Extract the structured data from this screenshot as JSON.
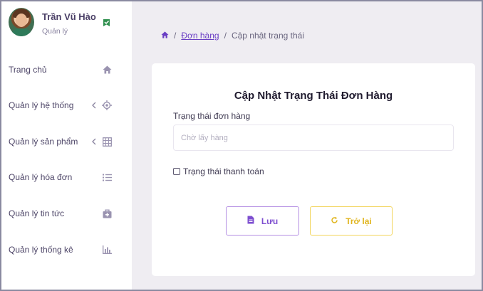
{
  "user": {
    "name": "Trần Vũ Hào",
    "role": "Quản lý"
  },
  "sidebar": {
    "items": [
      {
        "label": "Trang chủ",
        "icon": "home-icon",
        "has_chevron": false
      },
      {
        "label": "Quản lý hệ thống",
        "icon": "settings-target-icon",
        "has_chevron": true
      },
      {
        "label": "Quản lý sản phẩm",
        "icon": "grid-icon",
        "has_chevron": true
      },
      {
        "label": "Quản lý hóa đơn",
        "icon": "list-icon",
        "has_chevron": false
      },
      {
        "label": "Quản lý tin tức",
        "icon": "briefcase-plus-icon",
        "has_chevron": false
      },
      {
        "label": "Quản lý thống kê",
        "icon": "bar-chart-icon",
        "has_chevron": false
      }
    ]
  },
  "breadcrumb": {
    "separator": "/",
    "link": "Đơn hàng",
    "current": "Cập nhật trạng thái"
  },
  "form": {
    "title": "Cập Nhật Trạng Thái Đơn Hàng",
    "status_label": "Trạng thái đơn hàng",
    "status_placeholder": "Chờ lấy hàng",
    "payment_label": "Trạng thái thanh toán",
    "payment_checked": false,
    "save_label": "Lưu",
    "back_label": "Trở lại"
  },
  "colors": {
    "accent": "#7e4fd0",
    "warning": "#e0b51e",
    "background": "#efedf2"
  }
}
